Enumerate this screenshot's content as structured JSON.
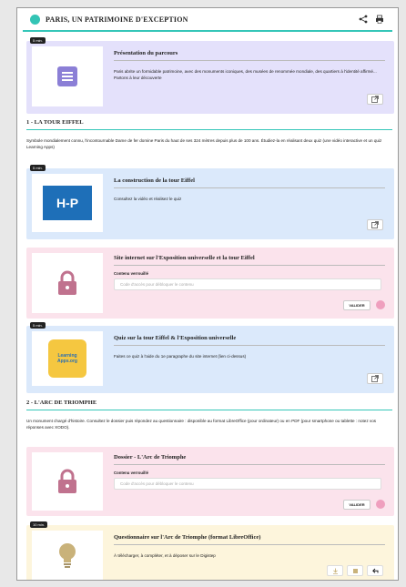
{
  "header": {
    "title": "PARIS, UN PATRIMOINE D'EXCEPTION",
    "share_icon": "share-icon",
    "print_icon": "print-icon"
  },
  "cards": {
    "presentation": {
      "badge": "5 min.",
      "title": "Présentation du parcours",
      "description": "Paris abrite un formidable patrimoine, avec des monuments iconiques, des musées de renommée mondiale, des quartiers à l'identité affirmé... Partons à leur découverte",
      "color": "#e4e1fb"
    },
    "construction": {
      "badge": "5 min.",
      "title": "La construction de la tour Eiffel",
      "description": "Consultez la vidéo et réalisez le quiz",
      "thumb_text": "H-P",
      "color": "#dbe9fb"
    },
    "site_internet": {
      "title": "Site internet sur l'Exposition universelle et la tour Eiffel",
      "locked_label": "Contenu verrouillé",
      "code_placeholder": "Code d'accès pour débloquer le contenu",
      "validate_label": "VALIDER",
      "color": "#fbe3ec"
    },
    "quiz": {
      "badge": "5 min.",
      "title": "Quiz sur la tour Eiffel & l'Exposition universelle",
      "description": "Faites ce quiz à l'aide du 1e paragraphe du site internet (lien ci-dessus)",
      "thumb_text_1": "Learning",
      "thumb_text_2": "Apps.org",
      "color": "#dbe9fb"
    },
    "dossier": {
      "title": "Dossier - L'Arc de Triomphe",
      "locked_label": "Contenu verrouillé",
      "code_placeholder": "Code d'accès pour débloquer le contenu",
      "validate_label": "VALIDER",
      "color": "#fbe3ec"
    },
    "questionnaire": {
      "badge": "10 min.",
      "title": "Questionnaire sur l'Arc de Triomphe (format LibreOffice)",
      "description": "À télécharger, à compléter, et à déposer sur le Digistep",
      "color": "#fdf5dc"
    }
  },
  "sections": {
    "tour_eiffel": {
      "heading": "1 - LA TOUR EIFFEL",
      "text": "Symbole mondialement connu, l'incontournable Dame de fer domine Paris du haut de ses 324 mètres depuis plus de 100 ans. Étudiez-la en réalisant deux quiz (une vidéo interactive et un quiz Learning Apps)"
    },
    "arc": {
      "heading": "2 - L'ARC DE TRIOMPHE",
      "text": "Un monument chargé d'histoire. Consultez le dossier puis répondez au questionnaire : disponible au format LibreOffice (pour ordinateur) ou en PDF (pour smartphone ou tablette : notez vos réponses avec XODO)."
    }
  },
  "colors": {
    "accent": "#35c6b8",
    "lock": "#c0728e",
    "doc_icon": "#8b7fd6",
    "bulb": "#c9b27a"
  }
}
